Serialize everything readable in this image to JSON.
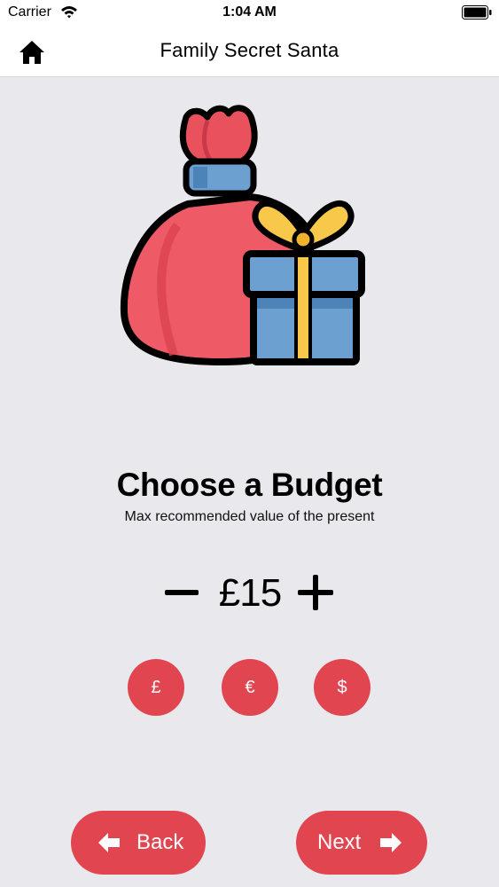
{
  "status_bar": {
    "carrier": "Carrier",
    "time": "1:04 AM"
  },
  "nav": {
    "title": "Family Secret Santa",
    "home_icon": "home-icon"
  },
  "content": {
    "heading": "Choose a Budget",
    "subheading": "Max recommended value of the present"
  },
  "budget": {
    "amount": "£15",
    "minus_icon": "minus-icon",
    "plus_icon": "plus-icon"
  },
  "currencies": [
    {
      "symbol": "£"
    },
    {
      "symbol": "€"
    },
    {
      "symbol": "$"
    }
  ],
  "footer": {
    "back_label": "Back",
    "next_label": "Next"
  },
  "colors": {
    "accent": "#e1454f",
    "background": "#e9e8ed"
  }
}
